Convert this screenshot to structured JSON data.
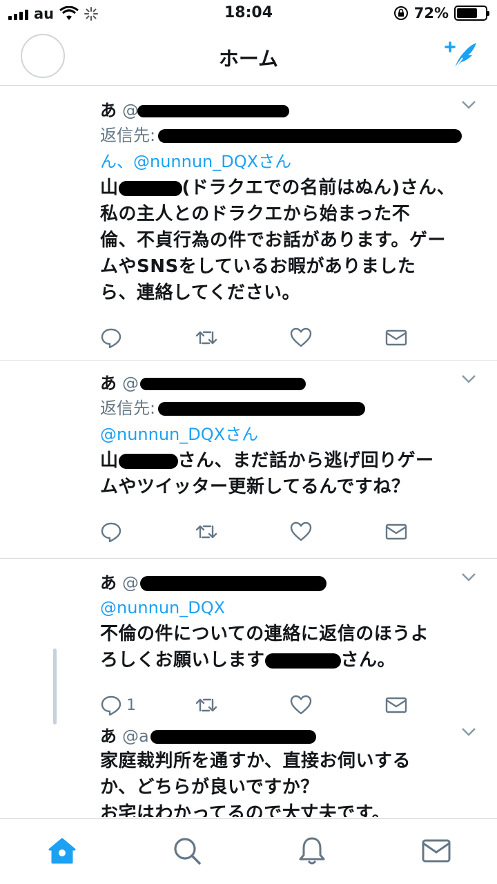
{
  "status_bar": {
    "carrier": "au",
    "time": "18:04",
    "battery_percent_label": "72%",
    "battery_level": 0.72
  },
  "nav": {
    "title": "ホーム",
    "left": "avatar",
    "right_icon": "compose-tweet-icon"
  },
  "colors": {
    "accent": "#1da1f2",
    "secondary_text": "#657786",
    "divider": "#d9dde1"
  },
  "tweets": [
    {
      "name": "あ",
      "handle_visible": "@",
      "reply_prefix": "返信先:",
      "reply_mention_line2": "ん、@nunnun_DQXさん",
      "body": [
        "山",
        "(ドラクエでの名前はぬん)さん、",
        "私の主人とのドラクエから始まった不",
        "倫、不貞行為の件でお話があります。ゲー",
        "ムやSNSをしているお暇がありました",
        "ら、連絡してください。"
      ]
    },
    {
      "name": "あ",
      "handle_visible": "@",
      "reply_prefix": "返信先:",
      "reply_mention_line2": "@nunnun_DQXさん",
      "body": [
        "山",
        "さん、まだ話から逃げ回りゲー",
        "ムやツイッター更新してるんですね？"
      ]
    },
    {
      "name": "あ",
      "handle_visible": "@",
      "mention_line": "@nunnun_DQX",
      "body": [
        "不倫の件についての連絡に返信のほうよ",
        "ろしくお願いします",
        "さん。"
      ],
      "reply_count": "1"
    },
    {
      "name": "あ",
      "handle_visible": "@a",
      "body": [
        "家庭裁判所を通すか、直接お伺いする",
        "か、どちらが良いですか？",
        "お宅はわかってるので大丈夫です。"
      ]
    }
  ],
  "tabbar": [
    "home-icon",
    "search-icon",
    "notifications-icon",
    "messages-icon"
  ]
}
